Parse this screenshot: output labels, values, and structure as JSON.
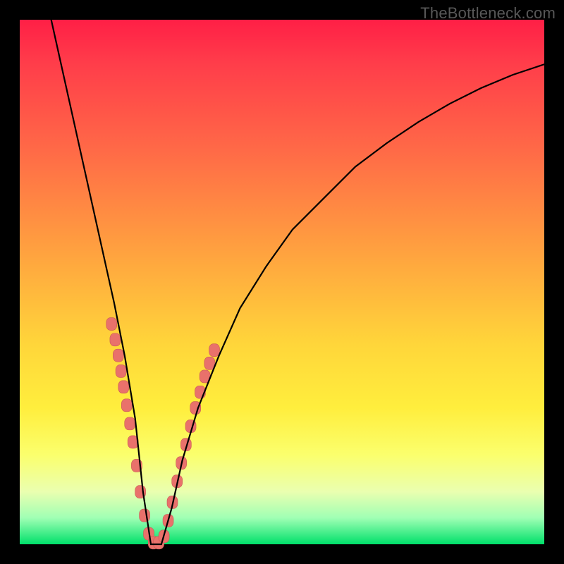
{
  "watermark": "TheBottleneck.com",
  "colors": {
    "gradient_top": "#ff1f46",
    "gradient_mid": "#ffd63a",
    "gradient_bottom": "#00e06a",
    "curve": "#000000",
    "marker": "#e9716b",
    "frame": "#000000"
  },
  "chart_data": {
    "type": "line",
    "title": "",
    "xlabel": "",
    "ylabel": "",
    "xlim": [
      0,
      100
    ],
    "ylim": [
      0,
      100
    ],
    "note": "No axes, ticks, or labels are rendered. The curve resembles a bottleneck V-shape; y represents mismatch (100 = top/red, 0 = bottom/green). Values are estimated from the image.",
    "series": [
      {
        "name": "bottleneck-curve",
        "x": [
          6,
          8,
          10,
          12,
          14,
          16,
          18,
          20,
          22,
          23.5,
          25,
          27,
          29,
          31,
          34,
          38,
          42,
          47,
          52,
          58,
          64,
          70,
          76,
          82,
          88,
          94,
          100
        ],
        "y": [
          100,
          91,
          82,
          73,
          64,
          55,
          46,
          36,
          24,
          10,
          0,
          0,
          7,
          16,
          26,
          36,
          45,
          53,
          60,
          66,
          72,
          76.5,
          80.5,
          84,
          87,
          89.5,
          91.5
        ]
      }
    ],
    "markers": {
      "note": "Pink rounded markers clustered on both arms of the V near the bottom.",
      "points": [
        {
          "x": 17.5,
          "y": 42
        },
        {
          "x": 18.2,
          "y": 39
        },
        {
          "x": 18.8,
          "y": 36
        },
        {
          "x": 19.3,
          "y": 33
        },
        {
          "x": 19.8,
          "y": 30
        },
        {
          "x": 20.4,
          "y": 26.5
        },
        {
          "x": 21.0,
          "y": 23
        },
        {
          "x": 21.6,
          "y": 19.5
        },
        {
          "x": 22.3,
          "y": 15
        },
        {
          "x": 23.0,
          "y": 10
        },
        {
          "x": 23.8,
          "y": 5.5
        },
        {
          "x": 24.6,
          "y": 2
        },
        {
          "x": 25.5,
          "y": 0.3
        },
        {
          "x": 26.5,
          "y": 0.3
        },
        {
          "x": 27.5,
          "y": 1.5
        },
        {
          "x": 28.3,
          "y": 4.5
        },
        {
          "x": 29.1,
          "y": 8
        },
        {
          "x": 30.0,
          "y": 12
        },
        {
          "x": 30.8,
          "y": 15.5
        },
        {
          "x": 31.7,
          "y": 19
        },
        {
          "x": 32.6,
          "y": 22.5
        },
        {
          "x": 33.5,
          "y": 26
        },
        {
          "x": 34.4,
          "y": 29
        },
        {
          "x": 35.3,
          "y": 32
        },
        {
          "x": 36.2,
          "y": 34.5
        },
        {
          "x": 37.1,
          "y": 37
        }
      ]
    }
  }
}
